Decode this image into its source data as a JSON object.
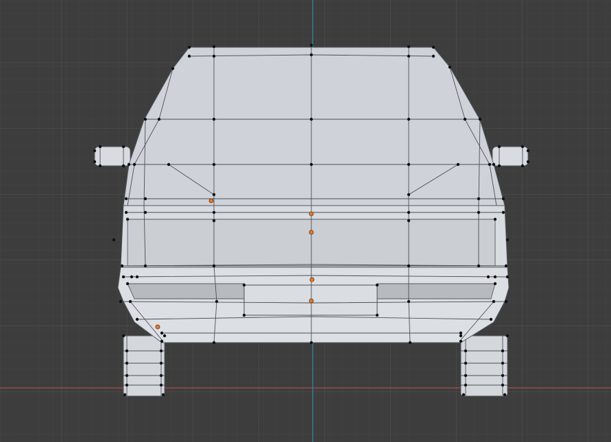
{
  "viewport": {
    "background_color": "#3d3d3d",
    "grid_color": "#4b4b4b",
    "x_axis_color": "#b5514f",
    "z_axis_color": "#2f8fa5",
    "mesh_face_color": "#d6d9de",
    "vertex_color": "#111111",
    "selected_vertex_color": "#e07b2c",
    "object": "car-rear-low-poly-mesh",
    "mode": "edit-mode-vertex-select",
    "selected_vertices_visible": 6
  }
}
